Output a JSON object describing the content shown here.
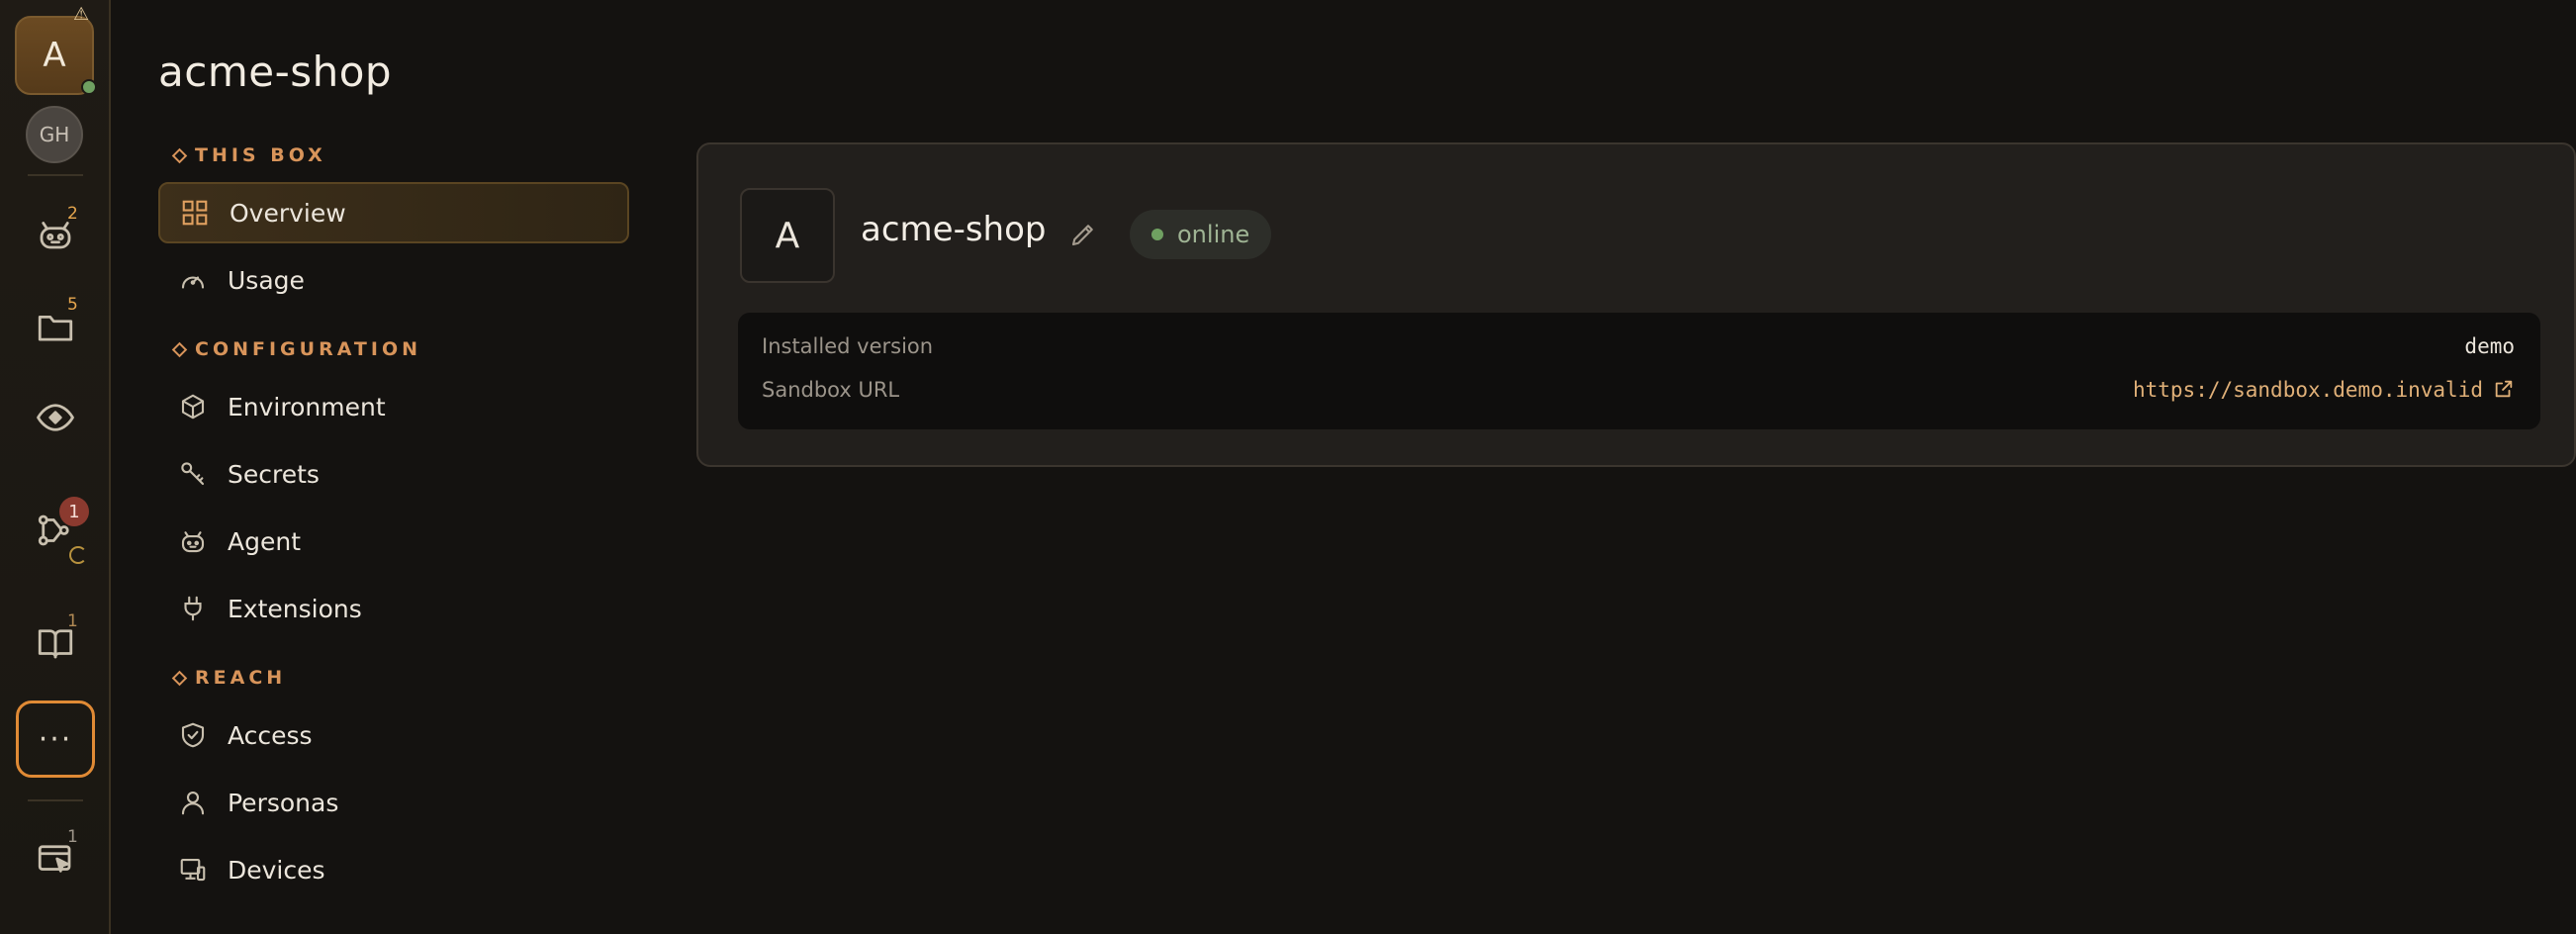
{
  "rail": {
    "avatar_letter": "A",
    "avatar_warning": "⚠",
    "account_initials": "GH",
    "agents_badge": "2",
    "files_badge": "5",
    "pipelines_badge": "1",
    "docs_badge": "1",
    "sessions_badge": "1",
    "more_label": "···",
    "accent_color": "#e08a35"
  },
  "page": {
    "title": "acme-shop"
  },
  "nav": {
    "sections": [
      {
        "label": "THIS BOX",
        "items": [
          {
            "label": "Overview",
            "icon": "grid-icon",
            "active": true
          },
          {
            "label": "Usage",
            "icon": "gauge-icon"
          }
        ]
      },
      {
        "label": "CONFIGURATION",
        "items": [
          {
            "label": "Environment",
            "icon": "cube-icon"
          },
          {
            "label": "Secrets",
            "icon": "key-icon"
          },
          {
            "label": "Agent",
            "icon": "robot-icon"
          },
          {
            "label": "Extensions",
            "icon": "plug-icon"
          }
        ]
      },
      {
        "label": "REACH",
        "items": [
          {
            "label": "Access",
            "icon": "shield-check-icon"
          },
          {
            "label": "Personas",
            "icon": "user-icon"
          },
          {
            "label": "Devices",
            "icon": "devices-icon"
          }
        ]
      }
    ]
  },
  "box": {
    "avatar_letter": "A",
    "name": "acme-shop",
    "status": "online",
    "status_color": "#6fa061",
    "installed_version_label": "Installed version",
    "installed_version": "demo",
    "sandbox_url_label": "Sandbox URL",
    "sandbox_url": "https://sandbox.demo.invalid",
    "link_color": "#e0b078"
  }
}
